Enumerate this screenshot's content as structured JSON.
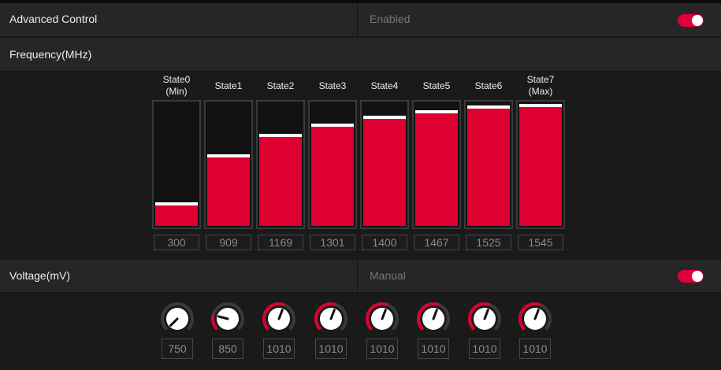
{
  "advanced_control": {
    "label": "Advanced Control",
    "status": "Enabled",
    "toggle_on": true
  },
  "frequency": {
    "label": "Frequency(MHz)",
    "range_max": 1600,
    "states": [
      {
        "label": "State0\n(Min)",
        "value": "300"
      },
      {
        "label": "State1",
        "value": "909"
      },
      {
        "label": "State2",
        "value": "1169"
      },
      {
        "label": "State3",
        "value": "1301"
      },
      {
        "label": "State4",
        "value": "1400"
      },
      {
        "label": "State5",
        "value": "1467"
      },
      {
        "label": "State6",
        "value": "1525"
      },
      {
        "label": "State7\n(Max)",
        "value": "1545"
      }
    ]
  },
  "voltage": {
    "label": "Voltage(mV)",
    "mode": "Manual",
    "toggle_on": true,
    "min": 750,
    "max": 1200,
    "values": [
      "750",
      "850",
      "1010",
      "1010",
      "1010",
      "1010",
      "1010",
      "1010"
    ]
  },
  "colors": {
    "accent": "#dd0031",
    "background": "#1a1a1a",
    "row": "#262626",
    "muted_text": "#777777"
  }
}
